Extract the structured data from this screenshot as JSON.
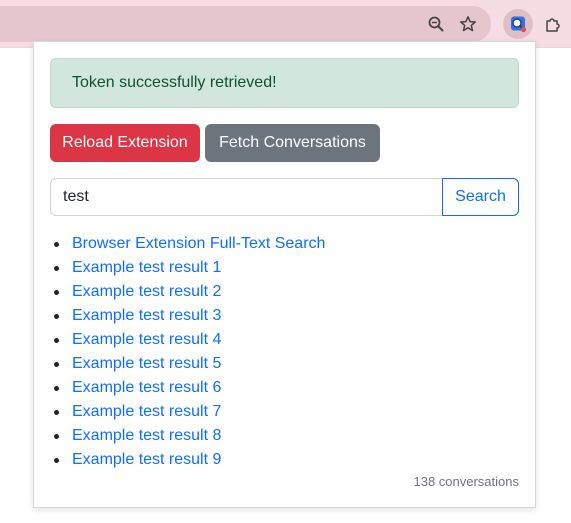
{
  "colors": {
    "toolbar_bg": "#f6dde2",
    "success_bg": "#d1e7dd",
    "success_text": "#0f5132",
    "danger": "#dc3545",
    "secondary": "#6c757d",
    "primary": "#0d6efd"
  },
  "toolbar": {
    "icons": [
      "zoom-icon",
      "bookmark-star-icon",
      "extension-active-icon",
      "extensions-puzzle-icon"
    ]
  },
  "popup": {
    "alert_text": "Token successfully retrieved!",
    "reload_button": "Reload Extension",
    "fetch_button": "Fetch Conversations",
    "search_value": "test",
    "search_button": "Search",
    "results": [
      "Browser Extension Full-Text Search",
      "Example test result 1",
      "Example test result 2",
      "Example test result 3",
      "Example test result 4",
      "Example test result 5",
      "Example test result 6",
      "Example test result 7",
      "Example test result 8",
      "Example test result 9"
    ],
    "count_text": "138 conversations"
  }
}
